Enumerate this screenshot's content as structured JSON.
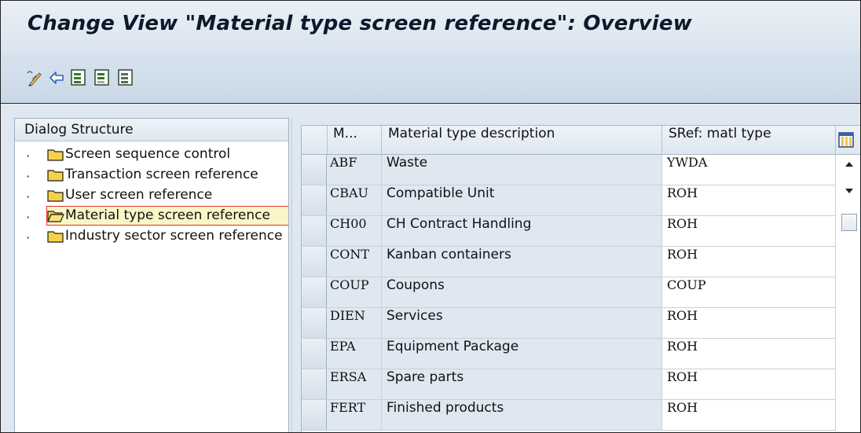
{
  "title": "Change View \"Material type screen reference\": Overview",
  "toolbar": {
    "icons": [
      "edit-pencil-icon",
      "undo-arrow-icon",
      "select-all-icon",
      "deselect-block-icon",
      "deselect-all-icon"
    ]
  },
  "dialog": {
    "header": "Dialog Structure",
    "items": [
      {
        "label": "Screen sequence control",
        "selected": false
      },
      {
        "label": "Transaction screen reference",
        "selected": false
      },
      {
        "label": "User screen reference",
        "selected": false
      },
      {
        "label": "Material type screen reference",
        "selected": true
      },
      {
        "label": "Industry sector screen reference",
        "selected": false
      }
    ],
    "bullet": "·"
  },
  "table": {
    "columns": [
      "M...",
      "Material type description",
      "SRef: matl type"
    ],
    "rows": [
      {
        "code": "ABF",
        "desc": "Waste",
        "ref": "YWDA"
      },
      {
        "code": "CBAU",
        "desc": "Compatible Unit",
        "ref": "ROH"
      },
      {
        "code": "CH00",
        "desc": "CH Contract Handling",
        "ref": "ROH"
      },
      {
        "code": "CONT",
        "desc": "Kanban containers",
        "ref": "ROH"
      },
      {
        "code": "COUP",
        "desc": "Coupons",
        "ref": "COUP"
      },
      {
        "code": "DIEN",
        "desc": "Services",
        "ref": "ROH"
      },
      {
        "code": "EPA",
        "desc": "Equipment Package",
        "ref": "ROH"
      },
      {
        "code": "ERSA",
        "desc": "Spare parts",
        "ref": "ROH"
      },
      {
        "code": "FERT",
        "desc": "Finished products",
        "ref": "ROH"
      }
    ]
  },
  "colors": {
    "title_bg": "#e2eaf2",
    "selection_highlight": "#fbf6c8",
    "selection_border": "#e2322d",
    "row_bg": "#dfe8f1"
  }
}
